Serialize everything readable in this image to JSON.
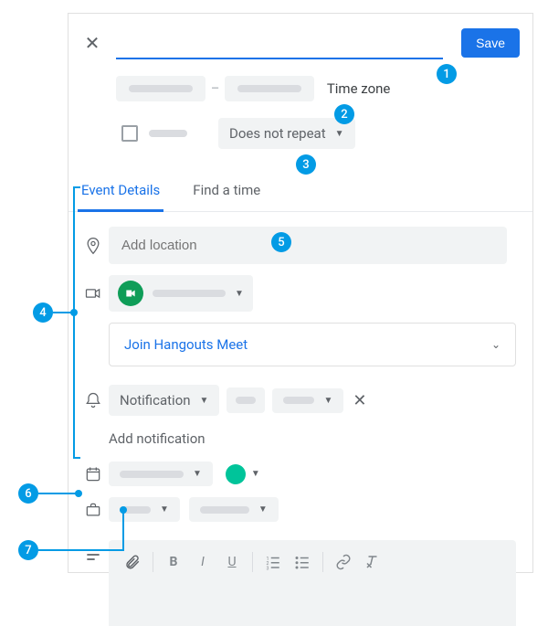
{
  "buttons": {
    "save": "Save"
  },
  "title_placeholder": "",
  "datetime": {
    "timezone_label": "Time zone"
  },
  "recurrence": {
    "label": "Does not repeat"
  },
  "tabs": {
    "details": "Event Details",
    "find": "Find a time"
  },
  "location": {
    "placeholder": "Add location"
  },
  "conferencing": {
    "join_label": "Join Hangouts Meet"
  },
  "reminder": {
    "label": "Notification",
    "add_label": "Add notification"
  },
  "callouts": {
    "c1": "1",
    "c2": "2",
    "c3": "3",
    "c4": "4",
    "c5": "5",
    "c6": "6",
    "c7": "7"
  }
}
